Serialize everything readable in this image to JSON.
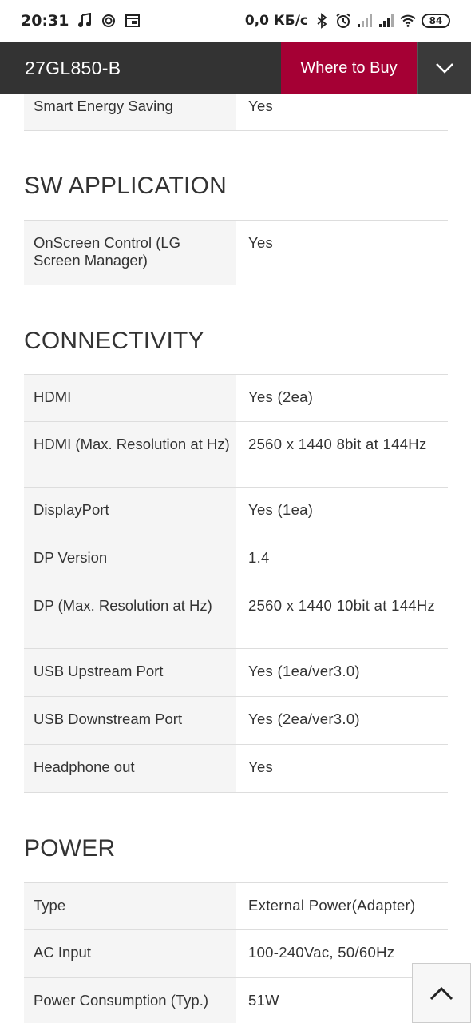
{
  "status_bar": {
    "time": "20:31",
    "net_speed": "0,0 КБ/с",
    "battery": "84",
    "icons": [
      "music-icon",
      "sync-icon",
      "notification-icon",
      "bluetooth-icon",
      "alarm-icon",
      "signal-icon",
      "signal-icon",
      "wifi-icon",
      "battery-icon"
    ]
  },
  "header": {
    "title": "27GL850-B",
    "where_to_buy": "Where to Buy",
    "accent_color": "#a50034",
    "expand_icon": "chevron-down-icon"
  },
  "sections": {
    "top_partial": {
      "rows": [
        {
          "label": "Smart Energy Saving",
          "value": "Yes"
        }
      ]
    },
    "sw_application": {
      "title": "SW APPLICATION",
      "rows": [
        {
          "label": "OnScreen Control (LG Screen Manager)",
          "value": "Yes"
        }
      ]
    },
    "connectivity": {
      "title": "CONNECTIVITY",
      "rows": [
        {
          "label": "HDMI",
          "value": "Yes (2ea)"
        },
        {
          "label": "HDMI (Max. Resolution at Hz)",
          "value": "2560 x 1440 8bit at 144Hz"
        },
        {
          "label": "DisplayPort",
          "value": "Yes (1ea)"
        },
        {
          "label": "DP Version",
          "value": "1.4"
        },
        {
          "label": "DP (Max. Resolution at Hz)",
          "value": "2560 x 1440 10bit at 144Hz"
        },
        {
          "label": "USB Upstream Port",
          "value": "Yes (1ea/ver3.0)"
        },
        {
          "label": "USB Downstream Port",
          "value": "Yes (2ea/ver3.0)"
        },
        {
          "label": "Headphone out",
          "value": "Yes"
        }
      ]
    },
    "power": {
      "title": "POWER",
      "rows": [
        {
          "label": "Type",
          "value": "External Power(Adapter)"
        },
        {
          "label": "AC Input",
          "value": "100-240Vac, 50/60Hz"
        },
        {
          "label": "Power Consumption (Typ.)",
          "value": "51W"
        }
      ]
    }
  },
  "scroll_top_icon": "chevron-up-icon"
}
